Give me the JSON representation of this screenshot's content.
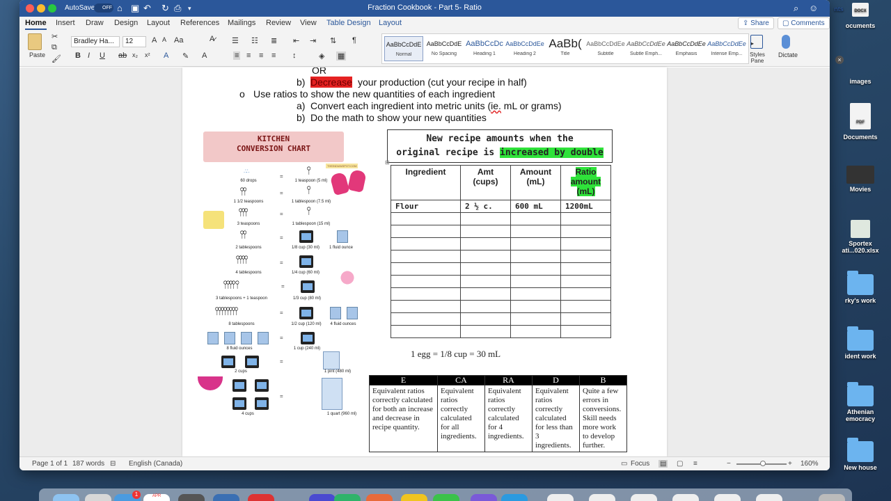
{
  "window": {
    "title": "Fraction Cookbook - Part 5- Ratio",
    "autosave_label": "AutoSave",
    "autosave_state": "OFF"
  },
  "tabs": [
    "Home",
    "Insert",
    "Draw",
    "Design",
    "Layout",
    "References",
    "Mailings",
    "Review",
    "View",
    "Table Design",
    "Layout"
  ],
  "share_label": "Share",
  "comments_label": "Comments",
  "ribbon": {
    "paste_label": "Paste",
    "font_name": "Bradley Ha...",
    "font_size": "12",
    "styles": [
      {
        "preview": "AaBbCcDdE",
        "name": "Normal"
      },
      {
        "preview": "AaBbCcDdE",
        "name": "No Spacing"
      },
      {
        "preview": "AaBbCcDc",
        "name": "Heading 1"
      },
      {
        "preview": "AaBbCcDdEe",
        "name": "Heading 2"
      },
      {
        "preview": "AaBb(",
        "name": "Title"
      },
      {
        "preview": "AaBbCcDdEe",
        "name": "Subtitle"
      },
      {
        "preview": "AaBbCcDdEe",
        "name": "Subtle Emph..."
      },
      {
        "preview": "AaBbCcDdEe",
        "name": "Emphasis"
      },
      {
        "preview": "AaBbCcDdEe",
        "name": "Intense Emp..."
      }
    ],
    "styles_pane_label": "Styles Pane",
    "dictate_label": "Dictate"
  },
  "doc": {
    "line_or": "OR",
    "line_b_prefix": "b)",
    "line_b_highlight": "Decrease",
    "line_b_rest": "your production (cut your recipe in half)",
    "bullet": "o",
    "line_ratios": "Use ratios to show the new quantities of each ingredient",
    "line_a_prefix": "a)",
    "line_a_1": "Convert each ingredient into metric units (",
    "line_a_ie": "ie.",
    "line_a_2": " mL or grams)",
    "line_b2_prefix": "b)",
    "line_b2": "Do the math to show your new quantities"
  },
  "chart": {
    "title_1": "KITCHEN",
    "title_2": "CONVERSION CHART",
    "site": "THEINDIANSPOT.COM",
    "eq": "=",
    "rows": [
      {
        "left": "60 drops",
        "right": "1 teaspoon (5 ml)"
      },
      {
        "left": "1 1/2 teaspoons",
        "right": "1 tablespoon (7.5 ml)"
      },
      {
        "left": "3 teaspoons",
        "right": "1 tablespoon (15 ml)"
      },
      {
        "left": "2 tablespoons",
        "right": "1/8 cup (30 ml)",
        "extra": "1 fluid ounce"
      },
      {
        "left": "4 tablespoons",
        "right": "1/4 cup (60 ml)"
      },
      {
        "left": "3 tablespoons + 1 teaspoon",
        "right": "1/3 cup (80 ml)"
      },
      {
        "left": "8 tablespoons",
        "right": "1/2 cup (120 ml)",
        "extra": "4 fluid ounces"
      },
      {
        "left": "8 fluid ounces",
        "right": "1 cup (240 ml)"
      },
      {
        "left": "2 cups",
        "right": "1 pint (480 ml)"
      },
      {
        "left": "4 cups",
        "right": "1 quart (960 ml)"
      }
    ]
  },
  "recipe": {
    "title_1": "New recipe amounts when the",
    "title_2a": "original recipe is ",
    "title_2b": "increased by double",
    "headers": [
      "Ingredient",
      "Amt",
      "(cups)",
      "Amount",
      "(mL)",
      "Ratio",
      "amount",
      "(mL)"
    ],
    "rows": [
      [
        "Flour",
        "2 ½ c.",
        "600 mL",
        "1200mL"
      ]
    ]
  },
  "egg_line": "1 egg = 1/8 cup = 30 mL",
  "grade": {
    "headers": [
      "E",
      "CA",
      "RA",
      "D",
      "B"
    ],
    "cells": [
      "Equivalent ratios correctly calculated for both an increase and decrease in recipe quantity.",
      "Equivalent ratios correctly calculated for all ingredients.",
      "Equivalent ratios correctly calculated for 4 ingredients.",
      "Equivalent ratios correctly calculated for less than 3 ingredients.",
      "Quite a few errors in conversions. Skill needs more work to develop further."
    ]
  },
  "status": {
    "page": "Page 1 of 1",
    "words": "187 words",
    "language": "English (Canada)",
    "focus": "Focus",
    "zoom": "160%"
  },
  "desktop": {
    "items": [
      "DOCX",
      "ocuments",
      "nts",
      "images",
      "PDF",
      "Documents",
      "Movies",
      "Sportex",
      "ati...020.xlsx",
      "rky's work",
      "ident work",
      "Athenian",
      "emocracy",
      "New house"
    ]
  },
  "dock_badge": "1",
  "dock_calendar": "APR"
}
